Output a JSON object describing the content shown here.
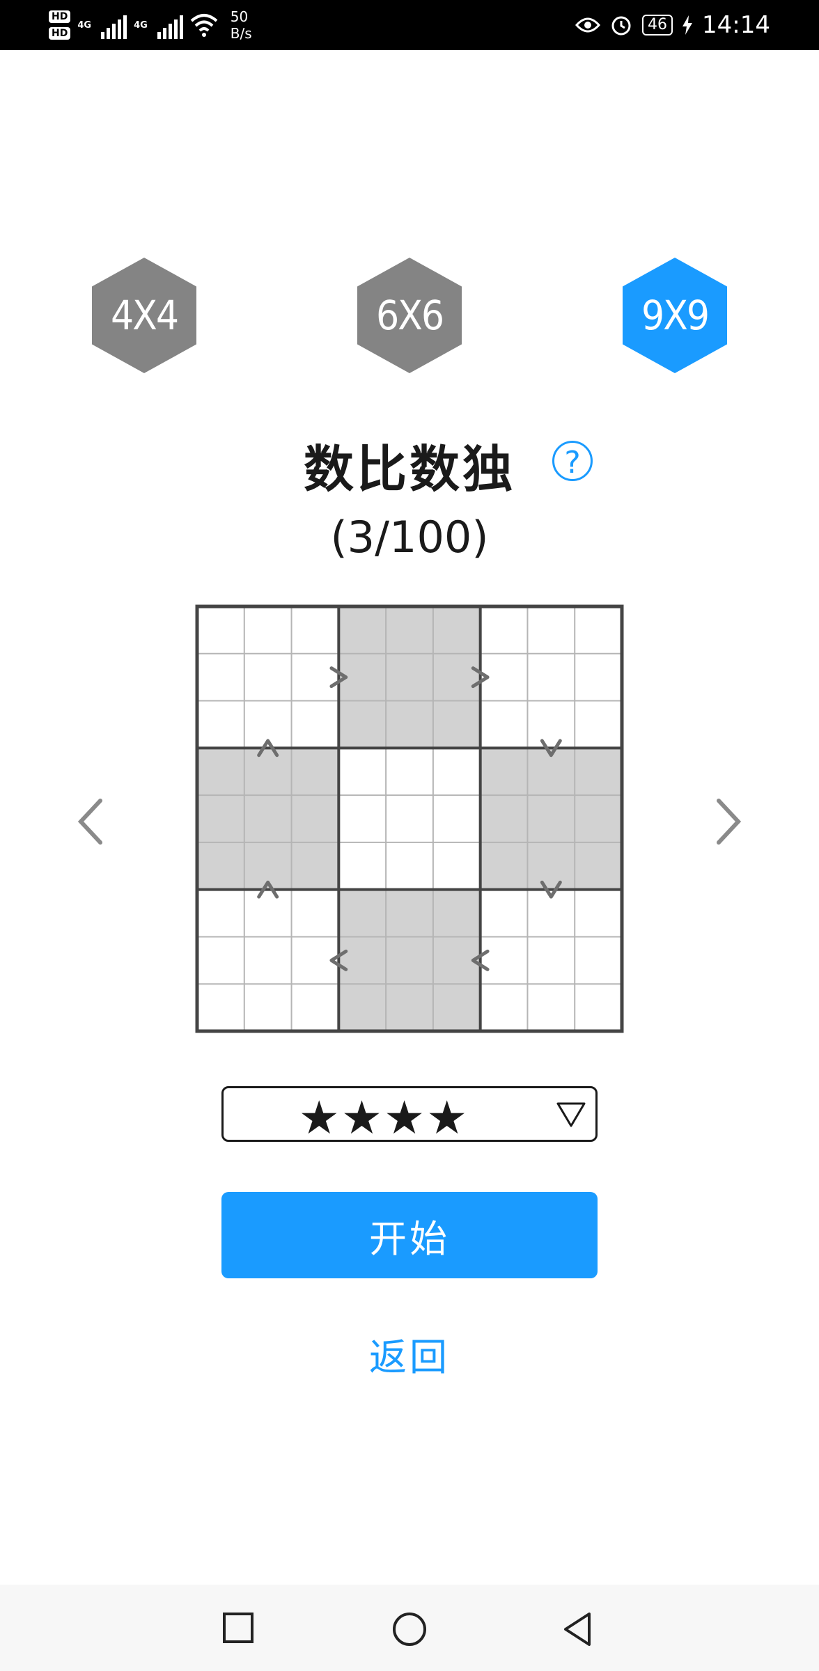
{
  "status_bar": {
    "hd1": "HD",
    "hd2": "HD",
    "net1": "4G",
    "net2": "4G",
    "speed_value": "50",
    "speed_unit": "B/s",
    "battery": "46",
    "time": "14:14",
    "icons": [
      "eye-icon",
      "alarm-icon",
      "battery-icon",
      "charging-icon"
    ]
  },
  "size_tabs": [
    {
      "label": "4X4",
      "selected": false
    },
    {
      "label": "6X6",
      "selected": false
    },
    {
      "label": "9X9",
      "selected": true
    }
  ],
  "title": "数比数独",
  "help_label": "?",
  "progress": "(3/100)",
  "nav": {
    "prev_icon": "chevron-left-icon",
    "next_icon": "chevron-right-icon"
  },
  "board": {
    "size": 9,
    "shaded_boxes": [
      [
        0,
        1
      ],
      [
        1,
        0
      ],
      [
        1,
        2
      ],
      [
        2,
        1
      ]
    ],
    "comparisons": [
      {
        "symbol": ">",
        "row": 1,
        "col": 2.5
      },
      {
        "symbol": ">",
        "row": 1,
        "col": 5.5
      },
      {
        "symbol": "^",
        "row": 2.5,
        "col": 1
      },
      {
        "symbol": "v",
        "row": 2.5,
        "col": 7
      },
      {
        "symbol": "^",
        "row": 5.5,
        "col": 1
      },
      {
        "symbol": "v",
        "row": 5.5,
        "col": 7
      },
      {
        "symbol": "<",
        "row": 7,
        "col": 2.5
      },
      {
        "symbol": "<",
        "row": 7,
        "col": 5.5
      }
    ]
  },
  "difficulty": {
    "stars": "★★★★",
    "value": 4,
    "dropdown_icon": "triangle-down-icon"
  },
  "start_button": "开始",
  "back_link": "返回",
  "system_nav": {
    "icons": [
      "square-recent-icon",
      "circle-home-icon",
      "triangle-back-icon"
    ]
  },
  "colors": {
    "accent": "#1a9bff",
    "hex_gray": "#848484",
    "shade": "#d2d2d2",
    "text": "#1a1a1a"
  }
}
